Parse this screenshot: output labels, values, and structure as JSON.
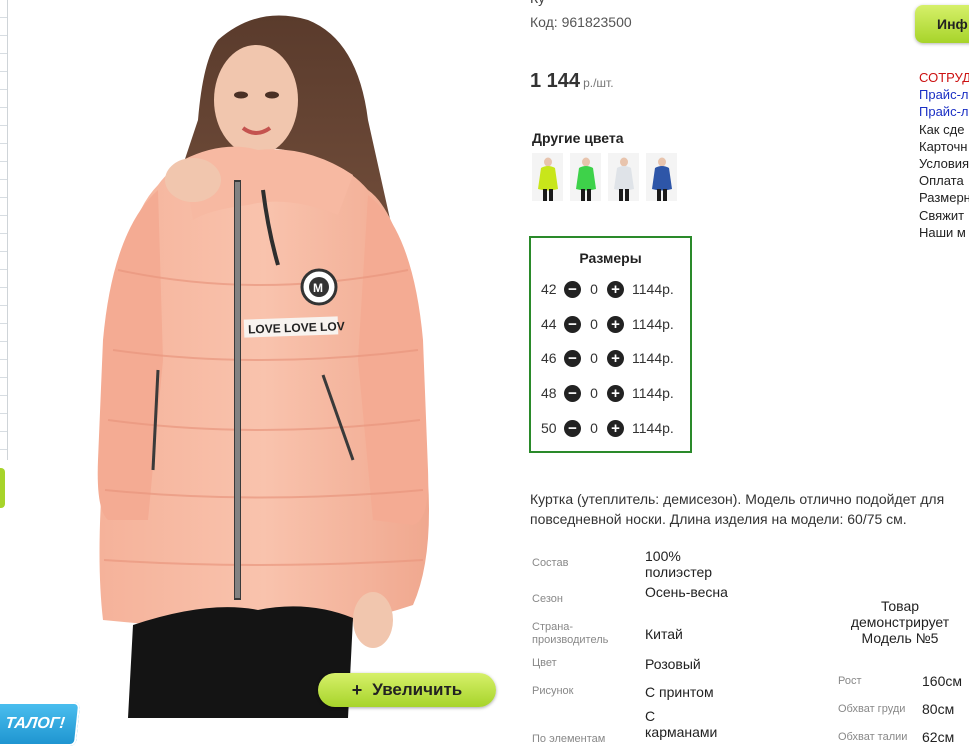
{
  "product": {
    "title_fragment": "Ку",
    "code_label": "Код: 961823500",
    "price_value": "1 144",
    "price_unit": "р./шт."
  },
  "other_colors": {
    "title": "Другие цвета",
    "swatches": [
      {
        "color": "#c8e61a",
        "name": "lime-jacket"
      },
      {
        "color": "#3ed24a",
        "name": "green-jacket"
      },
      {
        "color": "#dfe3e8",
        "name": "white-jacket"
      },
      {
        "color": "#2e56a8",
        "name": "blue-jacket"
      }
    ]
  },
  "sizes": {
    "title": "Размеры",
    "rows": [
      {
        "size": "42",
        "qty": "0",
        "price": "1144р."
      },
      {
        "size": "44",
        "qty": "0",
        "price": "1144р."
      },
      {
        "size": "46",
        "qty": "0",
        "price": "1144р."
      },
      {
        "size": "48",
        "qty": "0",
        "price": "1144р."
      },
      {
        "size": "50",
        "qty": "0",
        "price": "1144р."
      }
    ],
    "minus_icon": "minus-circle-icon",
    "plus_icon": "plus-circle-icon"
  },
  "description": "Куртка (утеплитель: демисезон). Модель отлично подойдет для повседневной носки. Длина изделия на модели: 60/75 см.",
  "properties": [
    {
      "label": "Состав",
      "value": "100% полиэстер"
    },
    {
      "label": "Сезон",
      "value": "Осень-весна"
    },
    {
      "label": "Страна-производитель",
      "value": "Китай"
    },
    {
      "label": "Цвет",
      "value": "Розовый"
    },
    {
      "label": "Рисунок",
      "value": "С принтом"
    },
    {
      "label": "По элементам",
      "value": "С карманами"
    }
  ],
  "model": {
    "title": "Товар демонстрирует Модель №5",
    "params": [
      {
        "label": "Рост",
        "value": "160см"
      },
      {
        "label": "Обхват груди",
        "value": "80см"
      },
      {
        "label": "Обхват талии",
        "value": "62см"
      }
    ]
  },
  "zoom_button": {
    "label": "Увеличить",
    "icon": "+"
  },
  "catalog_badge": "ТАЛОГ!",
  "info_button": "Инф",
  "right_links": [
    {
      "text": "СОТРУД",
      "color": "#cc1111"
    },
    {
      "text": "Прайс-л",
      "color": "#1a2fc4"
    },
    {
      "text": "Прайс-л",
      "color": "#1a2fc4"
    },
    {
      "text": "Как сде",
      "color": "#222222"
    },
    {
      "text": "Карточн",
      "color": "#222222"
    },
    {
      "text": "Условия",
      "color": "#222222"
    },
    {
      "text": "Оплата",
      "color": "#222222"
    },
    {
      "text": "Размерн",
      "color": "#222222"
    },
    {
      "text": "Свяжит",
      "color": "#222222"
    },
    {
      "text": "Наши м",
      "color": "#222222"
    }
  ],
  "colors": {
    "accent_green": "#a7d42a",
    "sizes_border": "#2a8a2a",
    "catalog_blue": "#1d93cf"
  }
}
